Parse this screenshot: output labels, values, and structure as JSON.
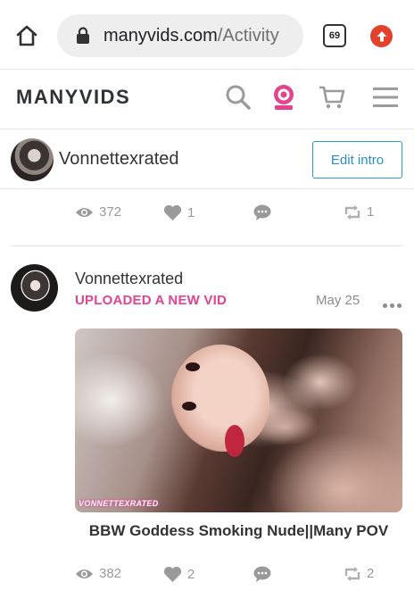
{
  "browser": {
    "url_domain": "manyvids.com",
    "url_path": "/Activity",
    "tab_count": "69"
  },
  "header": {
    "logo": "MANYVIDS",
    "icons": [
      "search-icon",
      "webcam-icon",
      "cart-icon",
      "menu-icon"
    ],
    "accent_color": "#e4438f"
  },
  "profile": {
    "name": "Vonnettexrated",
    "edit_label": "Edit intro"
  },
  "prev_post_stats": {
    "views": "372",
    "likes": "1",
    "reposts": "1"
  },
  "post": {
    "author": "Vonnettexrated",
    "action": "UPLOADED A NEW VID",
    "date": "May 25",
    "thumb_watermark": "VONNETTEXRATED",
    "title": "BBW Goddess Smoking Nude||Many POV",
    "stats": {
      "views": "382",
      "likes": "2",
      "reposts": "2"
    }
  }
}
